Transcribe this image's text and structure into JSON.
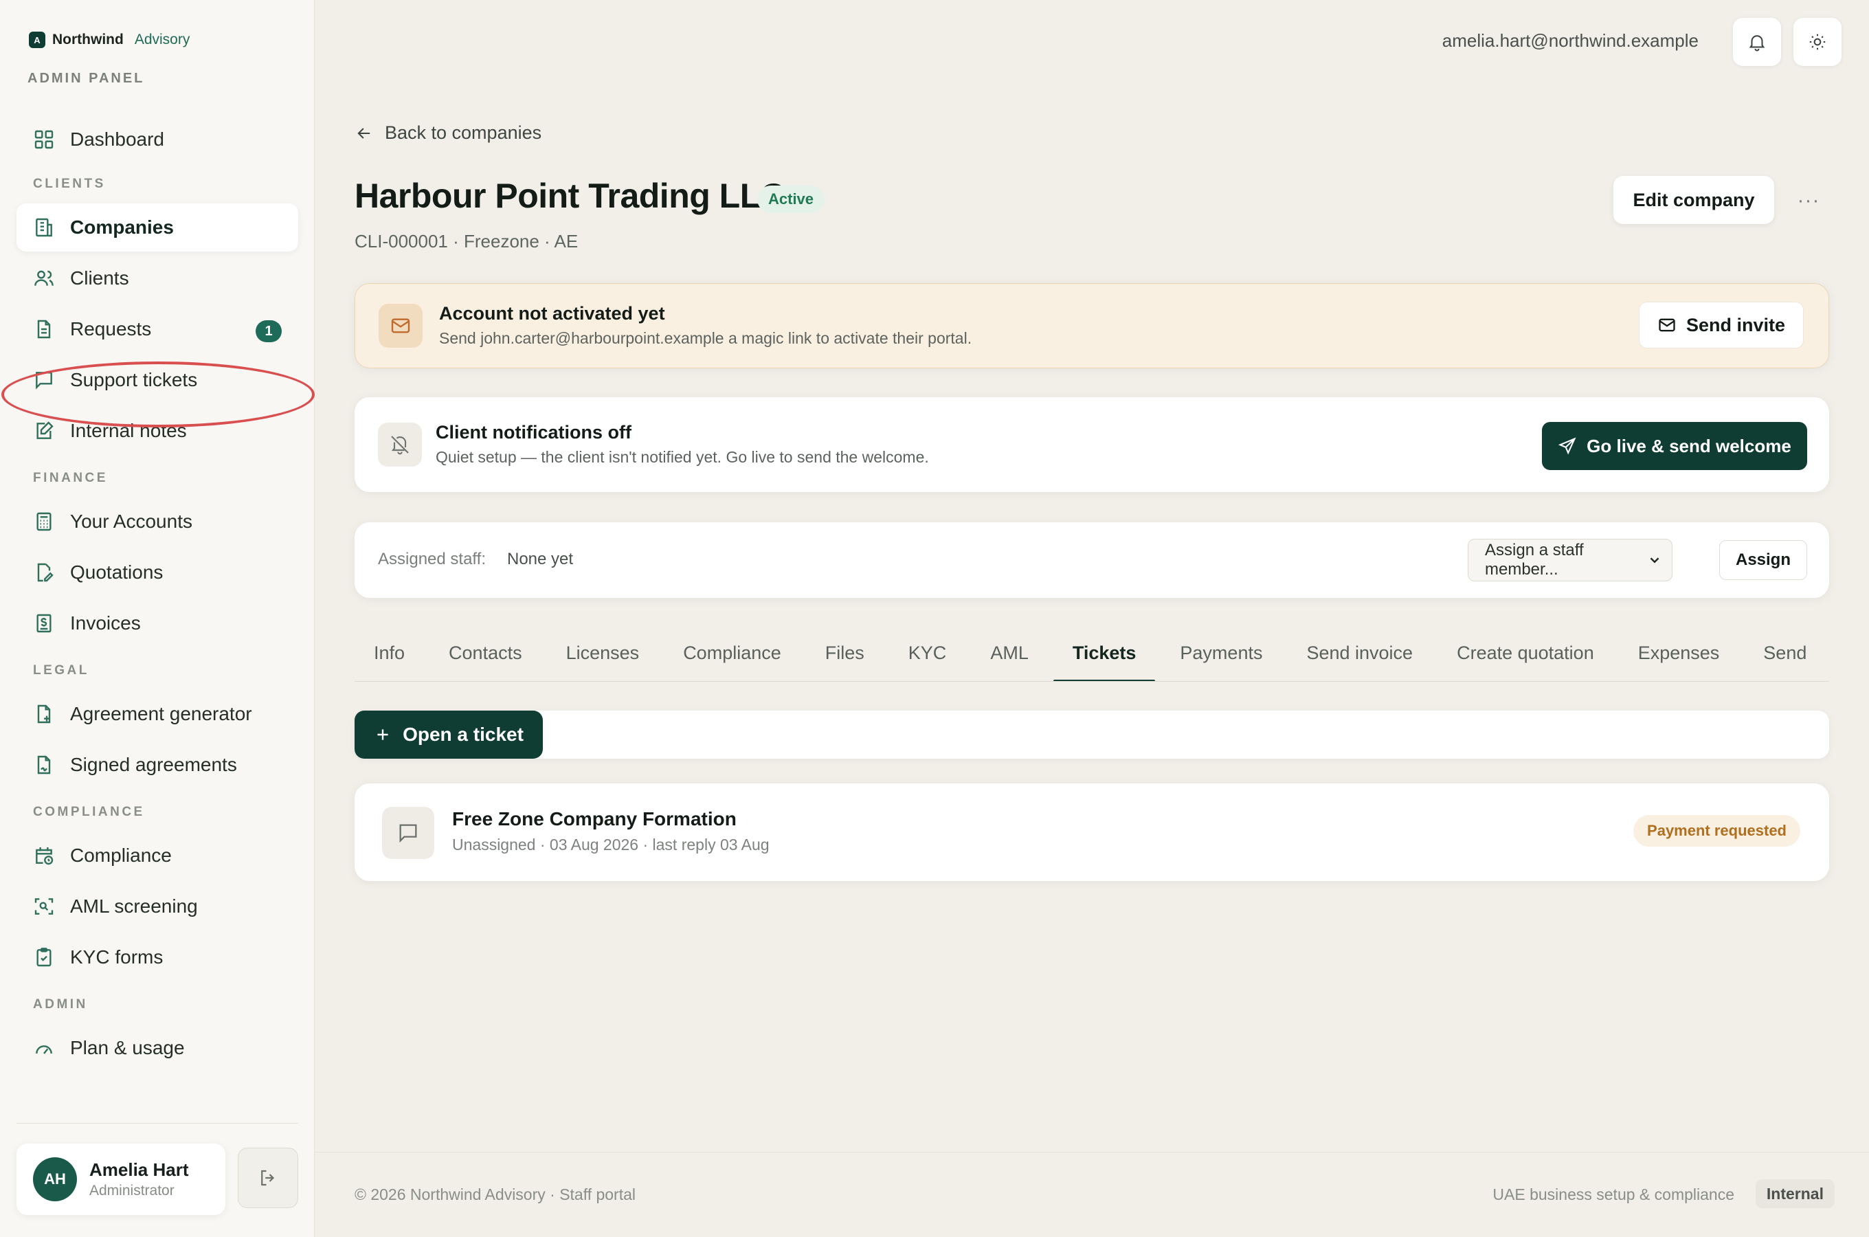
{
  "brand": {
    "mark": "A",
    "name": "Northwind",
    "sub": "Advisory"
  },
  "sidebar": {
    "panel_label": "ADMIN PANEL",
    "dashboard": "Dashboard",
    "sections": {
      "clients": "CLIENTS",
      "finance": "FINANCE",
      "legal": "LEGAL",
      "compliance": "COMPLIANCE",
      "admin": "ADMIN"
    },
    "items": {
      "companies": "Companies",
      "clients": "Clients",
      "requests": "Requests",
      "requests_badge": "1",
      "support_tickets": "Support tickets",
      "internal_notes": "Internal notes",
      "your_accounts": "Your Accounts",
      "quotations": "Quotations",
      "invoices": "Invoices",
      "agreement_generator": "Agreement generator",
      "signed_agreements": "Signed agreements",
      "compliance": "Compliance",
      "aml_screening": "AML screening",
      "kyc_forms": "KYC forms",
      "plan_usage": "Plan & usage"
    },
    "user": {
      "initials": "AH",
      "name": "Amelia Hart",
      "role": "Administrator"
    }
  },
  "topbar": {
    "email": "amelia.hart@northwind.example"
  },
  "page": {
    "back_link": "Back to companies",
    "company_name": "Harbour Point Trading LLC",
    "status": "Active",
    "meta": "CLI-000001 · Freezone · AE",
    "edit_button": "Edit company",
    "more_button": "···"
  },
  "activation_alert": {
    "title": "Account not activated yet",
    "description": "Send john.carter@harbourpoint.example a magic link to activate their portal.",
    "button": "Send invite"
  },
  "notifications_card": {
    "title": "Client notifications off",
    "description": "Quiet setup — the client isn't notified yet. Go live to send the welcome.",
    "button": "Go live & send welcome"
  },
  "staff_card": {
    "label": "Assigned staff:",
    "value": "None yet",
    "select_value": "Assign a staff member...",
    "assign_button": "Assign"
  },
  "tabs": [
    "Info",
    "Contacts",
    "Licenses",
    "Compliance",
    "Files",
    "KYC",
    "AML",
    "Tickets",
    "Payments",
    "Send invoice",
    "Create quotation",
    "Expenses",
    "Send"
  ],
  "active_tab": "Tickets",
  "tickets": {
    "open_button": "Open a ticket",
    "items": [
      {
        "title": "Free Zone Company Formation",
        "meta": "Unassigned · 03 Aug 2026 · last reply 03 Aug",
        "status": "Payment requested"
      }
    ]
  },
  "footer": {
    "left": "© 2026 Northwind Advisory · Staff portal",
    "right": "UAE business setup & compliance",
    "pill": "Internal"
  },
  "colors": {
    "accent_dark": "#0f3d33",
    "accent": "#1d6b58",
    "highlight": "#d94f4f",
    "warning_bg": "#faf0e2",
    "status_active": "#1f7a56"
  }
}
